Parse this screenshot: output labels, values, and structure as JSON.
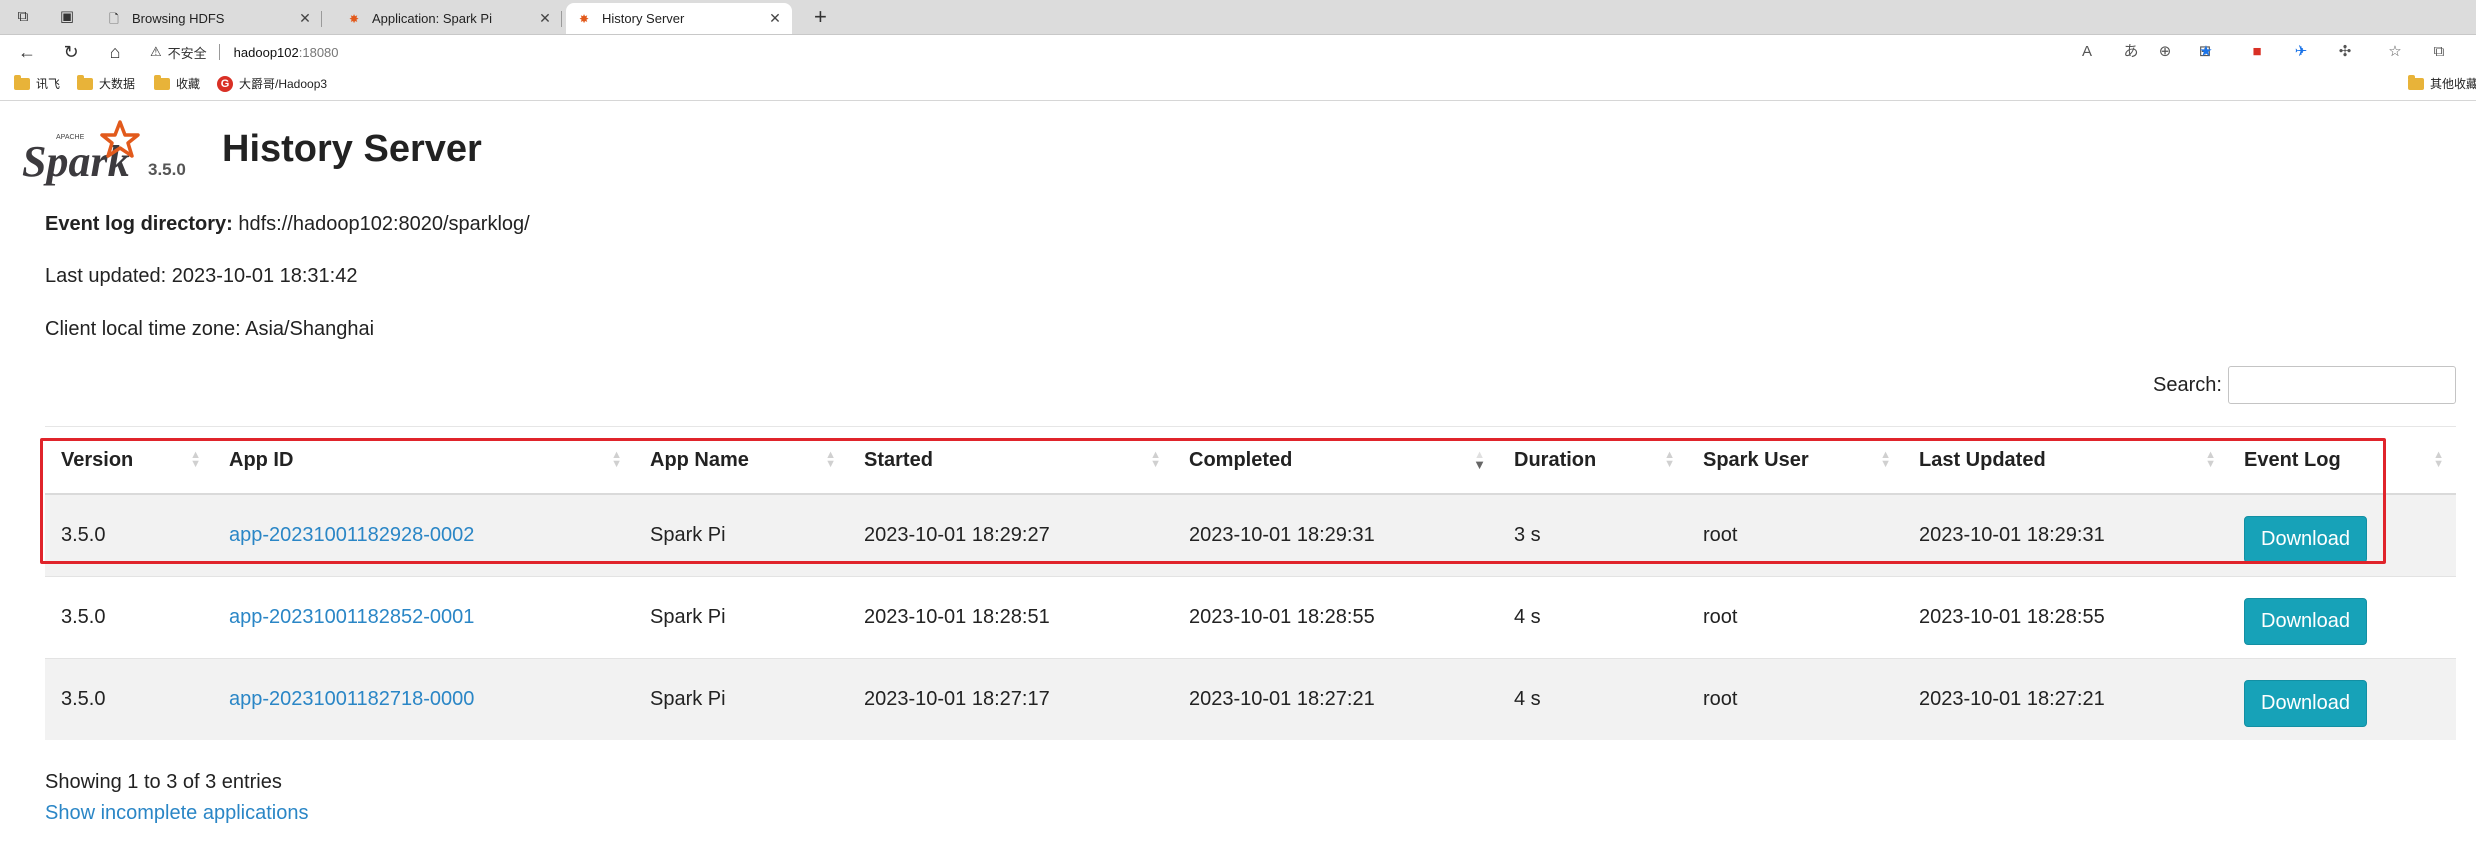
{
  "browser": {
    "tabs": [
      {
        "title": "Browsing HDFS",
        "icon": "page-icon",
        "active": false
      },
      {
        "title": "Application: Spark Pi",
        "icon": "spark-favicon",
        "active": false
      },
      {
        "title": "History Server",
        "icon": "spark-favicon",
        "active": true
      }
    ],
    "address": {
      "security_text": "不安全",
      "host": "hadoop102",
      "port": ":18080"
    },
    "bookmarks": [
      {
        "label": "讯飞",
        "icon": "folder-icon"
      },
      {
        "label": "大数据",
        "icon": "folder-icon"
      },
      {
        "label": "收藏",
        "icon": "folder-icon"
      },
      {
        "label": "大爵哥/Hadoop3",
        "icon": "g-icon"
      },
      {
        "label": "其他收藏",
        "icon": "folder-icon"
      }
    ],
    "g_icon_letter": "G"
  },
  "header": {
    "logo_apache": "APACHE",
    "logo_text": "Spark",
    "version": "3.5.0",
    "title": "History Server"
  },
  "info": {
    "event_log_label": "Event log directory:",
    "event_log_value": "hdfs://hadoop102:8020/sparklog/",
    "last_updated": "Last updated: 2023-10-01 18:31:42",
    "timezone": "Client local time zone: Asia/Shanghai"
  },
  "search": {
    "label": "Search:",
    "value": ""
  },
  "table": {
    "columns": [
      "Version",
      "App ID",
      "App Name",
      "Started",
      "Completed",
      "Duration",
      "Spark User",
      "Last Updated",
      "Event Log"
    ],
    "sorted_column": "Completed",
    "sort_direction": "descending",
    "rows": [
      {
        "version": "3.5.0",
        "app_id": "app-20231001182928-0002",
        "app_name": "Spark Pi",
        "started": "2023-10-01 18:29:27",
        "completed": "2023-10-01 18:29:31",
        "duration": "3 s",
        "user": "root",
        "last_updated": "2023-10-01 18:29:31",
        "event_log": "Download"
      },
      {
        "version": "3.5.0",
        "app_id": "app-20231001182852-0001",
        "app_name": "Spark Pi",
        "started": "2023-10-01 18:28:51",
        "completed": "2023-10-01 18:28:55",
        "duration": "4 s",
        "user": "root",
        "last_updated": "2023-10-01 18:28:55",
        "event_log": "Download"
      },
      {
        "version": "3.5.0",
        "app_id": "app-20231001182718-0000",
        "app_name": "Spark Pi",
        "started": "2023-10-01 18:27:17",
        "completed": "2023-10-01 18:27:21",
        "duration": "4 s",
        "user": "root",
        "last_updated": "2023-10-01 18:27:21",
        "event_log": "Download"
      }
    ]
  },
  "footer": {
    "showing": "Showing 1 to 3 of 3 entries",
    "incomplete_link": "Show incomplete applications"
  },
  "colors": {
    "link": "#2a86c6",
    "download_button": "#17a2b8",
    "highlight_box": "#e0242b",
    "spark_logo_orange": "#e25a1c"
  }
}
